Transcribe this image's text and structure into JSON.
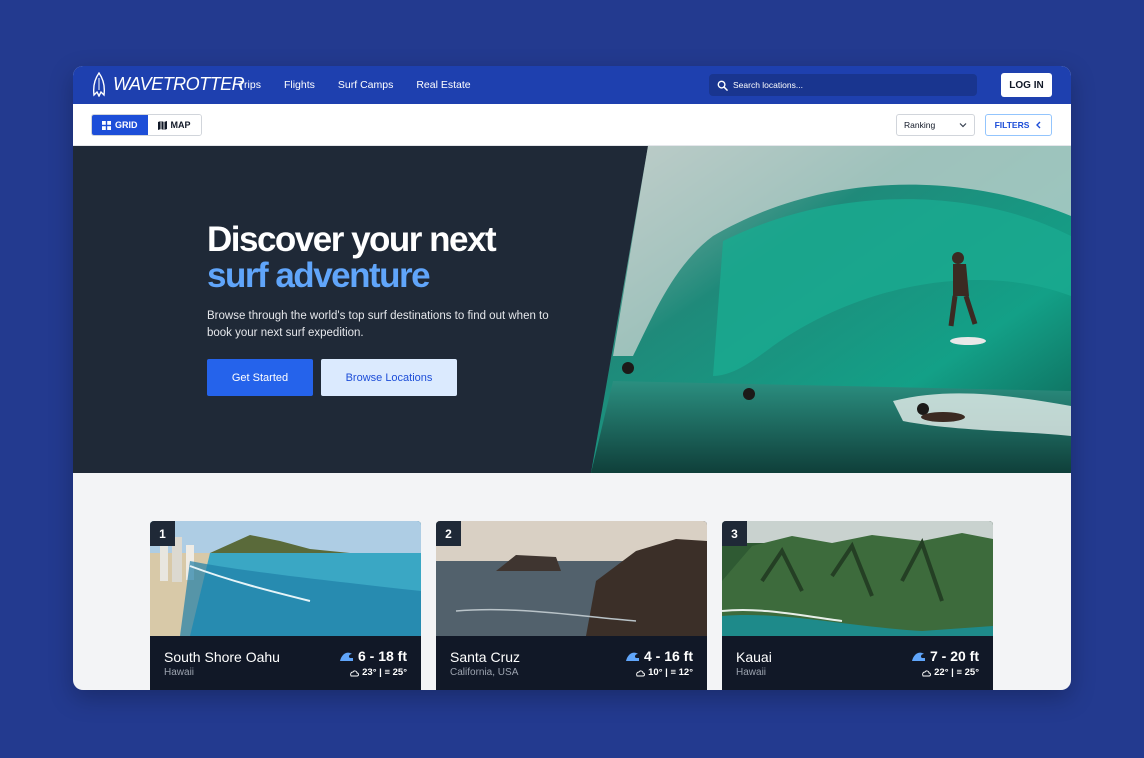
{
  "header": {
    "brand": "WAVETROTTER",
    "nav": [
      "Trips",
      "Flights",
      "Surf Camps",
      "Real Estate"
    ],
    "search_placeholder": "Search locations...",
    "login_label": "LOG IN"
  },
  "toolbar": {
    "grid_label": "GRID",
    "map_label": "MAP",
    "sort_value": "Ranking",
    "filters_label": "FILTERS"
  },
  "hero": {
    "title_line1": "Discover your next",
    "title_line2": "surf adventure",
    "subtitle": "Browse through the world's top surf destinations to find out when to book your next surf expedition.",
    "primary_cta": "Get Started",
    "secondary_cta": "Browse Locations"
  },
  "cards": [
    {
      "rank": "1",
      "name": "South Shore Oahu",
      "region": "Hawaii",
      "swell": "6 - 18 ft",
      "weather": "23° | ≡ 25°"
    },
    {
      "rank": "2",
      "name": "Santa Cruz",
      "region": "California, USA",
      "swell": "4 - 16 ft",
      "weather": "10° | ≡ 12°"
    },
    {
      "rank": "3",
      "name": "Kauai",
      "region": "Hawaii",
      "swell": "7 - 20 ft",
      "weather": "22° | ≡ 25°"
    }
  ],
  "colors": {
    "brand_blue": "#1e40af",
    "accent": "#60a5fa",
    "primary_button": "#2563eb",
    "hero_bg": "#1f2937"
  }
}
